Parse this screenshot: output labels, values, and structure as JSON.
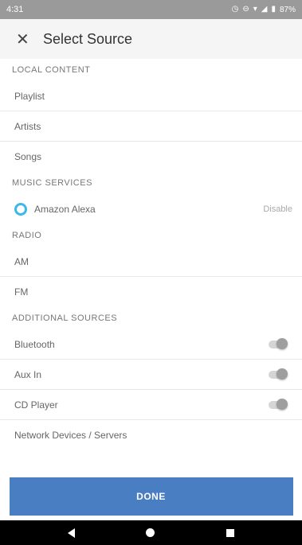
{
  "status_bar": {
    "time": "4:31",
    "battery": "87%"
  },
  "app_bar": {
    "title": "Select Source"
  },
  "sections": {
    "local": {
      "header": "LOCAL CONTENT",
      "items": [
        "Playlist",
        "Artists",
        "Songs"
      ]
    },
    "music_services": {
      "header": "MUSIC SERVICES",
      "alexa_label": "Amazon Alexa",
      "alexa_action": "Disable"
    },
    "radio": {
      "header": "RADIO",
      "items": [
        "AM",
        "FM"
      ]
    },
    "additional": {
      "header": "ADDITIONAL SOURCES",
      "items": [
        "Bluetooth",
        "Aux In",
        "CD Player",
        "Network Devices / Servers"
      ],
      "toggles": {
        "bluetooth": false,
        "aux_in": false,
        "cd_player": false
      }
    }
  },
  "done_label": "DONE",
  "colors": {
    "accent": "#4a7ec2",
    "alexa": "#3db8e8",
    "status_bar": "#9a9a9a",
    "app_bar": "#f5f5f5"
  },
  "icons": {
    "close": "close-icon",
    "alexa": "alexa-icon",
    "back": "back-icon",
    "home": "home-icon",
    "recents": "recents-icon"
  }
}
